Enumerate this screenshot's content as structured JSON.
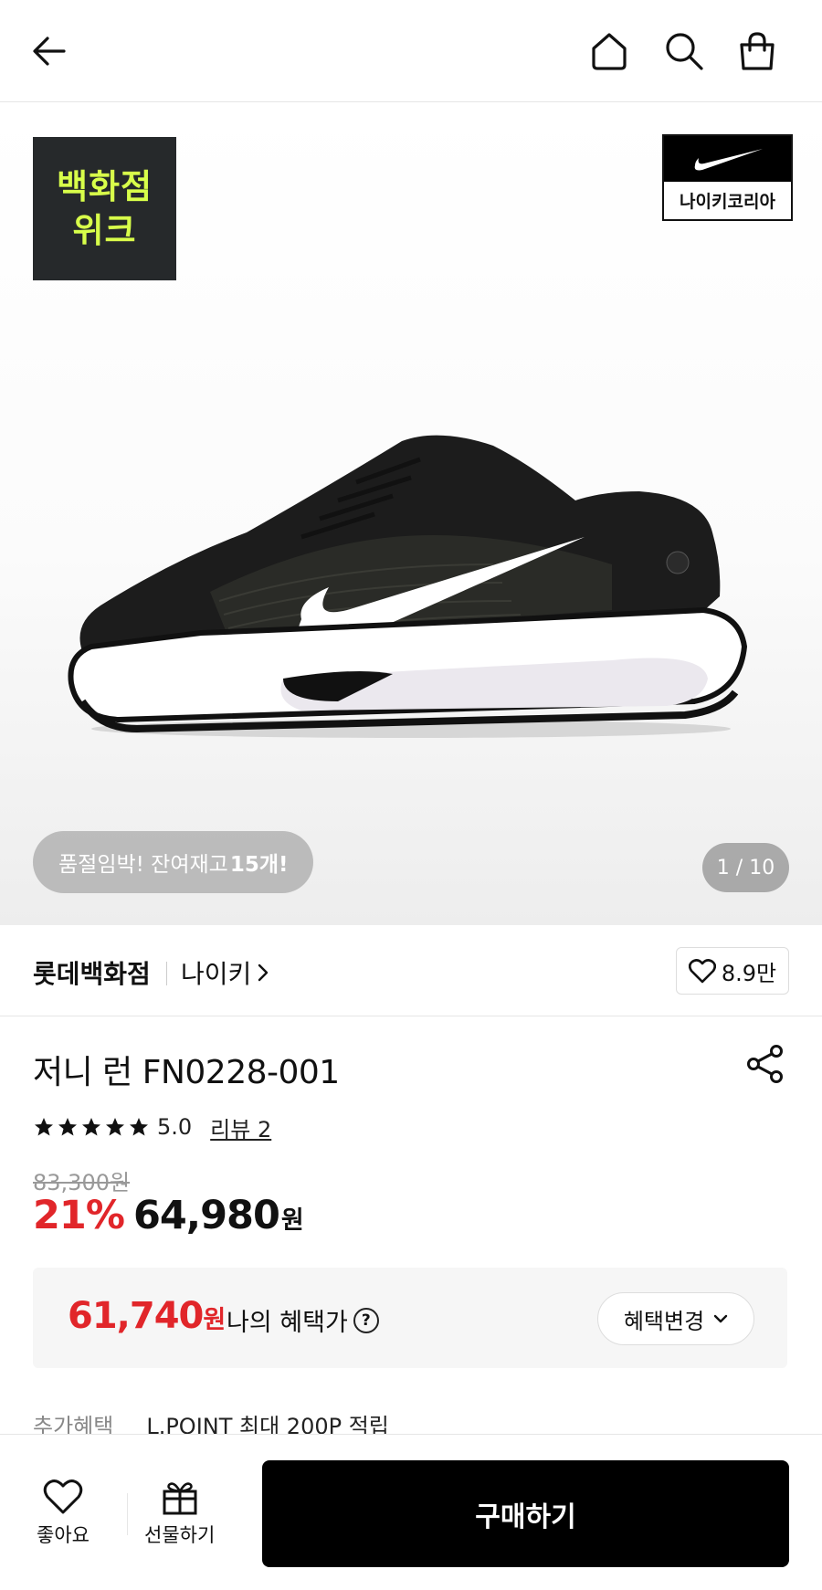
{
  "header": {
    "back_icon": "arrow-left-icon",
    "home_icon": "home-icon",
    "search_icon": "search-icon",
    "cart_icon": "shopping-bag-icon"
  },
  "hero": {
    "promo_badge_line1": "백화점",
    "promo_badge_line2": "위크",
    "promo_badge_color": "#d8ff4a",
    "brand_logo_text": "나이키코리아",
    "stock_prefix": "품절임박! 잔여재고 ",
    "stock_count": "15개!",
    "image_counter": "1 / 10"
  },
  "store": {
    "name": "롯데백화점",
    "brand": "나이키",
    "like_count": "8.9만"
  },
  "product": {
    "title": "저니 런 FN0228-001",
    "rating": "5.0",
    "stars": 5,
    "review_link": "리뷰 2",
    "original_price": "83,300원",
    "discount_rate": "21%",
    "sale_price": "64,980",
    "currency": "원",
    "accent_color": "#e1262a"
  },
  "benefit": {
    "price": "61,740",
    "currency": "원",
    "label": "나의 혜택가",
    "help": "?",
    "change_button": "혜택변경"
  },
  "extra": {
    "label": "추가혜택",
    "text": "L.POINT 최대 200P 적립"
  },
  "bottom_bar": {
    "like_label": "좋아요",
    "gift_label": "선물하기",
    "buy_label": "구매하기"
  }
}
